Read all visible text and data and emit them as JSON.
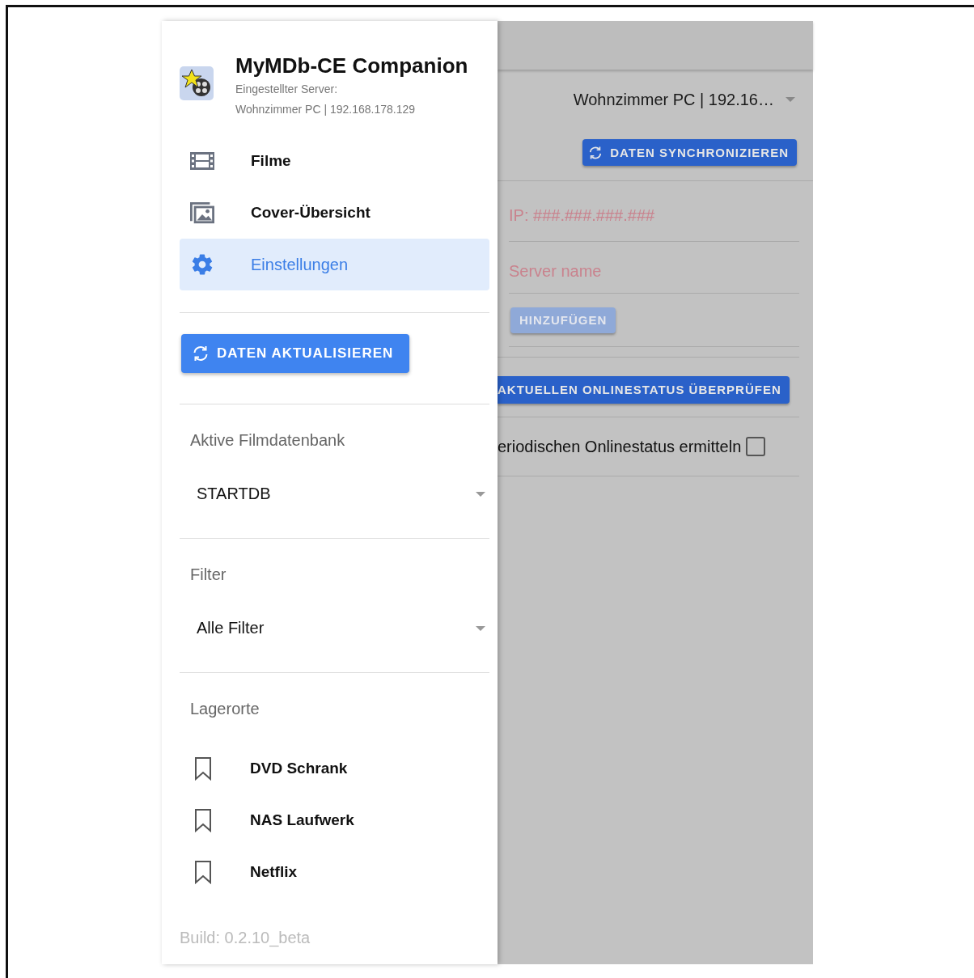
{
  "drawer": {
    "app_title": "MyMDb-CE Companion",
    "server_label": "Eingestellter Server:",
    "server_value": "Wohnzimmer PC | 192.168.178.129",
    "nav": [
      {
        "label": "Filme",
        "kind": "film",
        "selected": false
      },
      {
        "label": "Cover-Übersicht",
        "kind": "images",
        "selected": false
      },
      {
        "label": "Einstellungen",
        "kind": "gear",
        "selected": true
      }
    ],
    "refresh_button": "DATEN AKTUALISIEREN",
    "selects": [
      {
        "label": "Aktive Filmdatenbank",
        "value": "STARTDB"
      },
      {
        "label": "Filter",
        "value": "Alle Filter"
      }
    ],
    "storage": {
      "label": "Lagerorte",
      "items": [
        "DVD Schrank",
        "NAS Laufwerk",
        "Netflix"
      ]
    },
    "build": "Build: 0.2.10_beta"
  },
  "main": {
    "server_select": "Wohnzimmer PC | 192.16…",
    "sync_button": "DATEN SYNCHRONIZIEREN",
    "ip_field": {
      "placeholder": "IP: ###.###.###.###"
    },
    "name_field": {
      "placeholder": "Server name"
    },
    "add_button": {
      "label": "HINZUFÜGEN",
      "disabled": true
    },
    "status_button": "AKTUELLEN ONLINESTATUS ÜBERPRÜFEN",
    "periodic": {
      "label": "eriodischen Onlinestatus ermitteln",
      "checked": false
    }
  }
}
